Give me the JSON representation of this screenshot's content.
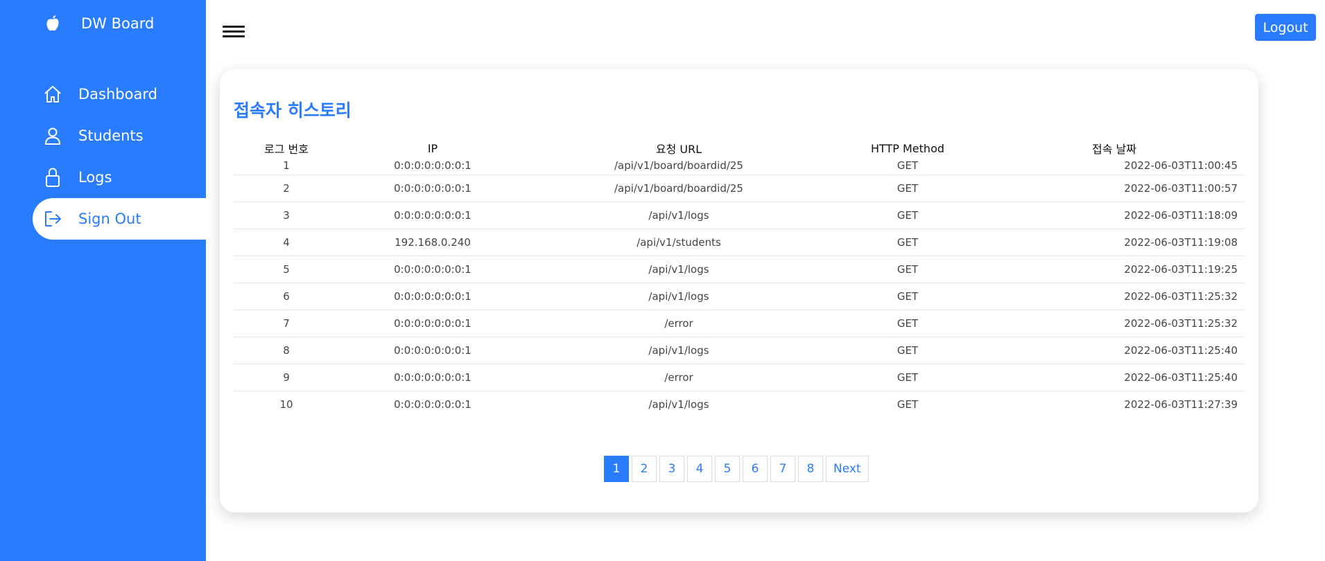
{
  "sidebar": {
    "brand": {
      "title": "DW Board",
      "icon": "apple-icon"
    },
    "items": [
      {
        "label": "Dashboard",
        "icon": "home-icon",
        "active": false
      },
      {
        "label": "Students",
        "icon": "person-icon",
        "active": false
      },
      {
        "label": "Logs",
        "icon": "lock-icon",
        "active": false
      },
      {
        "label": "Sign Out",
        "icon": "sign-out-icon",
        "active": true
      }
    ]
  },
  "header": {
    "menu_icon": "hamburger-icon",
    "logout_label": "Logout"
  },
  "main": {
    "title": "접속자 히스토리",
    "table": {
      "columns": [
        "로그 번호",
        "IP",
        "요청 URL",
        "HTTP Method",
        "접속 날짜"
      ],
      "rows": [
        [
          "1",
          "0:0:0:0:0:0:0:1",
          "/api/v1/board/boardid/25",
          "GET",
          "2022-06-03T11:00:45"
        ],
        [
          "2",
          "0:0:0:0:0:0:0:1",
          "/api/v1/board/boardid/25",
          "GET",
          "2022-06-03T11:00:57"
        ],
        [
          "3",
          "0:0:0:0:0:0:0:1",
          "/api/v1/logs",
          "GET",
          "2022-06-03T11:18:09"
        ],
        [
          "4",
          "192.168.0.240",
          "/api/v1/students",
          "GET",
          "2022-06-03T11:19:08"
        ],
        [
          "5",
          "0:0:0:0:0:0:0:1",
          "/api/v1/logs",
          "GET",
          "2022-06-03T11:19:25"
        ],
        [
          "6",
          "0:0:0:0:0:0:0:1",
          "/api/v1/logs",
          "GET",
          "2022-06-03T11:25:32"
        ],
        [
          "7",
          "0:0:0:0:0:0:0:1",
          "/error",
          "GET",
          "2022-06-03T11:25:32"
        ],
        [
          "8",
          "0:0:0:0:0:0:0:1",
          "/api/v1/logs",
          "GET",
          "2022-06-03T11:25:40"
        ],
        [
          "9",
          "0:0:0:0:0:0:0:1",
          "/error",
          "GET",
          "2022-06-03T11:25:40"
        ],
        [
          "10",
          "0:0:0:0:0:0:0:1",
          "/api/v1/logs",
          "GET",
          "2022-06-03T11:27:39"
        ]
      ]
    },
    "pagination": {
      "pages": [
        "1",
        "2",
        "3",
        "4",
        "5",
        "6",
        "7",
        "8"
      ],
      "current": "1",
      "next_label": "Next"
    }
  },
  "colors": {
    "accent": "#2a7cff",
    "background": "#ffffff"
  }
}
